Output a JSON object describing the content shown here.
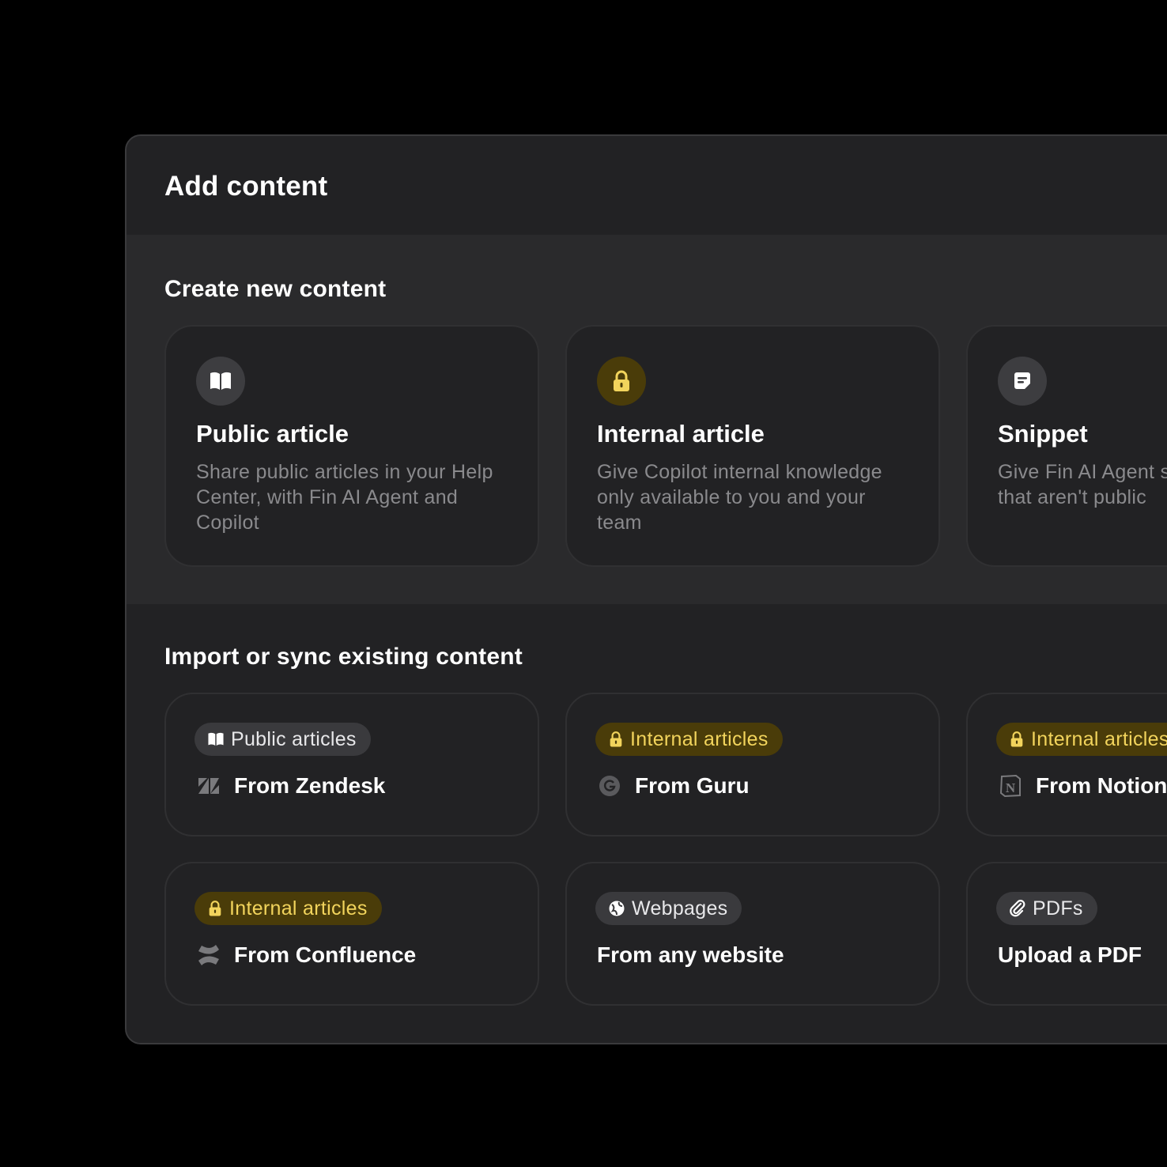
{
  "panel": {
    "title": "Add content"
  },
  "create": {
    "title": "Create new content",
    "cards": [
      {
        "icon": "book-icon",
        "title": "Public article",
        "description": "Share public articles in your Help Center, with Fin AI Agent and Copilot"
      },
      {
        "icon": "lock-icon",
        "title": "Internal article",
        "description": "Give Copilot internal knowledge only available to you and your team"
      },
      {
        "icon": "note-icon",
        "title": "Snippet",
        "description": "Give Fin AI Agent snippets of text that aren't public"
      }
    ]
  },
  "import": {
    "title": "Import or sync existing content",
    "cards": [
      {
        "pill": "Public articles",
        "pill_style": "gray",
        "pill_icon": "book-icon",
        "source": "From Zendesk",
        "source_icon": "zendesk-icon"
      },
      {
        "pill": "Internal articles",
        "pill_style": "gold",
        "pill_icon": "lock-icon",
        "source": "From Guru",
        "source_icon": "guru-icon"
      },
      {
        "pill": "Internal articles",
        "pill_style": "gold",
        "pill_icon": "lock-icon",
        "source": "From Notion",
        "source_icon": "notion-icon"
      },
      {
        "pill": "Internal articles",
        "pill_style": "gold",
        "pill_icon": "lock-icon",
        "source": "From Confluence",
        "source_icon": "confluence-icon"
      },
      {
        "pill": "Webpages",
        "pill_style": "gray",
        "pill_icon": "globe-icon",
        "source": "From any website",
        "source_icon": ""
      },
      {
        "pill": "PDFs",
        "pill_style": "gray",
        "pill_icon": "paperclip-icon",
        "source": "Upload a PDF",
        "source_icon": ""
      }
    ]
  },
  "colors": {
    "background": "#000000",
    "panel": "#232325",
    "section": "#2a2a2c",
    "gold_bg": "#4a3c09",
    "gold_text": "#f2d45c",
    "muted_text": "#8a8a8d"
  }
}
